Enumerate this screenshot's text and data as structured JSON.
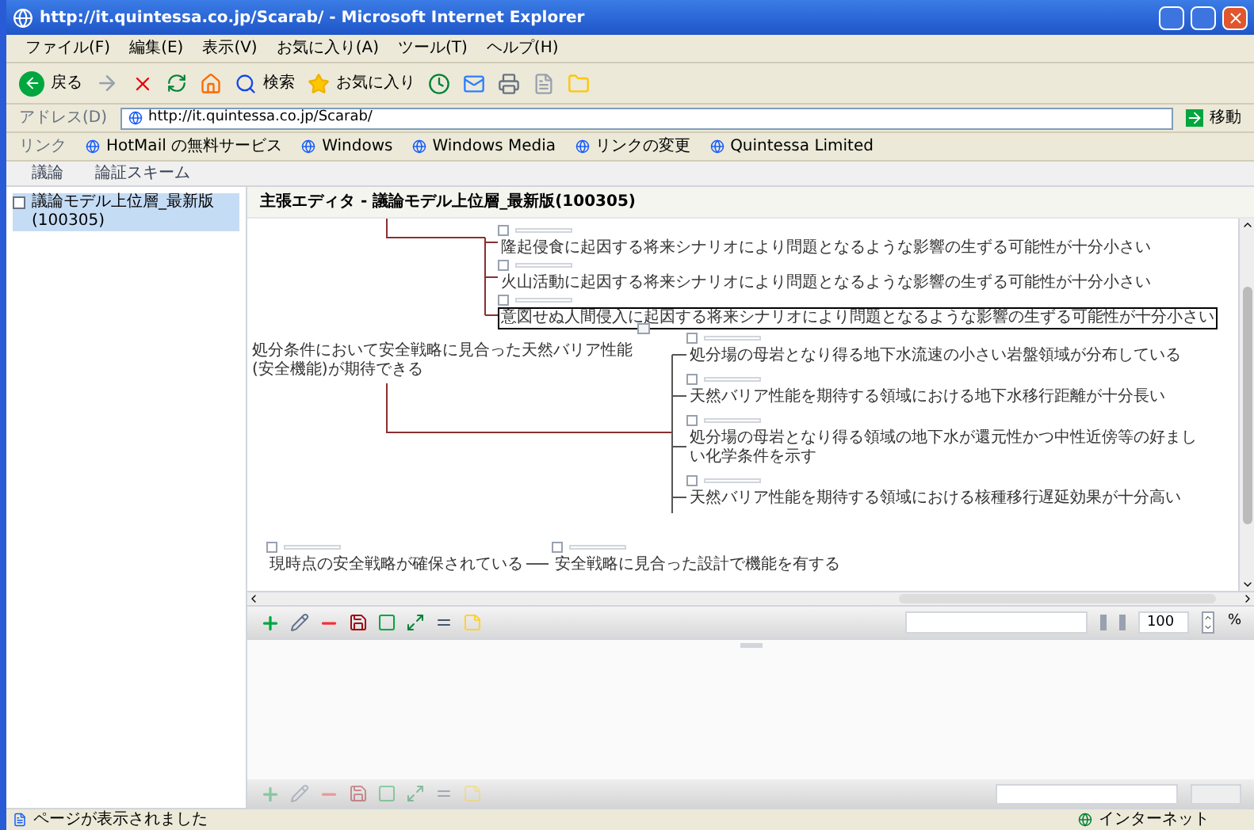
{
  "window": {
    "title": "http://it.quintessa.co.jp/Scarab/ - Microsoft Internet Explorer"
  },
  "menu": [
    "ファイル(F)",
    "編集(E)",
    "表示(V)",
    "お気に入り(A)",
    "ツール(T)",
    "ヘルプ(H)"
  ],
  "toolbar": {
    "back_label": "戻る",
    "search_label": "検索",
    "favorites_label": "お気に入り"
  },
  "address": {
    "label": "アドレス(D)",
    "url": "http://it.quintessa.co.jp/Scarab/",
    "go_label": "移動"
  },
  "links": {
    "label": "リンク",
    "items": [
      "HotMail の無料サービス",
      "Windows",
      "Windows Media",
      "リンクの変更",
      "Quintessa Limited"
    ]
  },
  "app_tabs": [
    "議論",
    "論証スキーム"
  ],
  "sidebar": {
    "items": [
      {
        "label": "議論モデル上位層_最新版(100305)",
        "selected": true,
        "checked": false
      }
    ]
  },
  "editor": {
    "title": "主張エディタ - 議論モデル上位層_最新版(100305)"
  },
  "diagram": {
    "top_nodes": [
      {
        "text": "隆起侵食に起因する将来シナリオにより問題となるような影響の生ずる可能性が十分小さい",
        "selected": false,
        "checked": false
      },
      {
        "text": "火山活動に起因する将来シナリオにより問題となるような影響の生ずる可能性が十分小さい",
        "selected": false,
        "checked": false
      },
      {
        "text": "意図せぬ人間侵入に起因する将来シナリオにより問題となるような影響の生ずる可能性が十分小さい",
        "selected": true,
        "checked": false
      }
    ],
    "root": {
      "text": "処分条件において安全戦略に見合った天然バリア性能(安全機能)が期待できる",
      "selected": false
    },
    "children": [
      {
        "text": "処分場の母岩となり得る地下水流速の小さい岩盤領域が分布している",
        "selected": false,
        "checked": false
      },
      {
        "text": "天然バリア性能を期待する領域における地下水移行距離が十分長い",
        "selected": false,
        "checked": false
      },
      {
        "text": "処分場の母岩となり得る領域の地下水が還元性かつ中性近傍等の好ましい化学条件を示す",
        "selected": false,
        "checked": false
      },
      {
        "text": "天然バリア性能を期待する領域における核種移行遅延効果が十分高い",
        "selected": false,
        "checked": false
      }
    ],
    "bottom_nodes": [
      {
        "text": "現時点の安全戦略が確保されている",
        "selected": false,
        "checked": false
      },
      {
        "text": "安全戦略に見合った設計で機能を有する",
        "selected": false,
        "checked": false
      }
    ]
  },
  "editor_toolbar": {
    "zoom": "100",
    "zoom_unit": "%"
  },
  "status": {
    "text": "ページが表示されました",
    "zone": "インターネット"
  }
}
